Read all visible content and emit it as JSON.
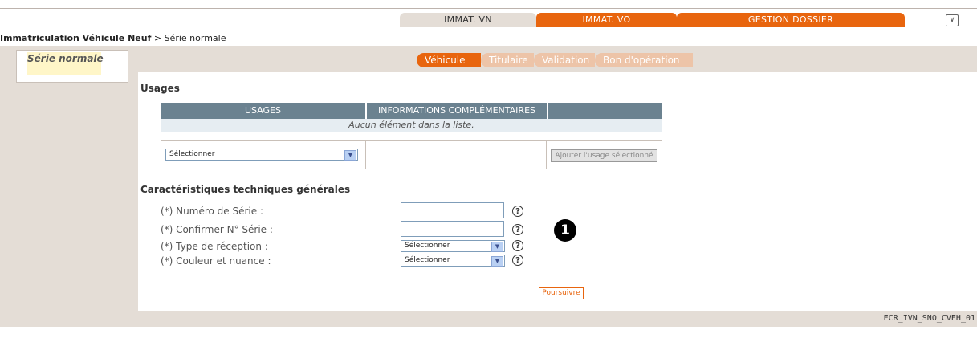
{
  "tabs": [
    {
      "label": "IMMAT. VN"
    },
    {
      "label": "IMMAT. VO"
    },
    {
      "label": "GESTION DOSSIER"
    }
  ],
  "breadcrumb": {
    "bold": "Immatriculation Véhicule Neuf",
    "separator": ">",
    "current": "Série normale"
  },
  "sidebar": {
    "item": "Série normale"
  },
  "steps": [
    "Véhicule",
    "Titulaire",
    "Validation",
    "Bon d'opération"
  ],
  "usages": {
    "title": "Usages",
    "columns": [
      "USAGES",
      "INFORMATIONS COMPLÉMENTAIRES",
      ""
    ],
    "empty_text": "Aucun élément dans la liste.",
    "select_value": "Sélectionner",
    "add_button": "Ajouter l'usage sélectionné"
  },
  "caracteristiques": {
    "title": "Caractéristiques techniques générales",
    "fields": [
      {
        "label": "(*) Numéro de Série :"
      },
      {
        "label": "(*) Confirmer N° Série :"
      },
      {
        "label": "(*) Type de réception :",
        "value": "Sélectionner"
      },
      {
        "label": "(*) Couleur et nuance :",
        "value": "Sélectionner"
      }
    ],
    "help_symbol": "?"
  },
  "badge": "1",
  "submit_button": "Poursuivre",
  "screen_id": "ECR_IVN_SNO_CVEH_01",
  "colors": {
    "accent": "#e8650e",
    "table_header": "#6b8290",
    "panel_bg": "#e4ddd6"
  }
}
